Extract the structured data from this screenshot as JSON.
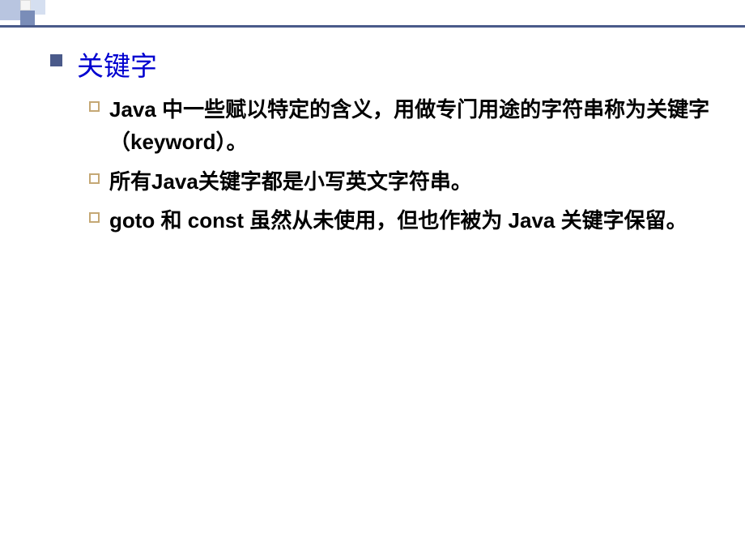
{
  "heading": "关键字",
  "items": [
    "Java 中一些赋以特定的含义，用做专门用途的字符串称为关键字（keyword）。",
    "所有Java关键字都是小写英文字符串。",
    "goto 和 const  虽然从未使用，但也作被为 Java 关键字保留。"
  ]
}
